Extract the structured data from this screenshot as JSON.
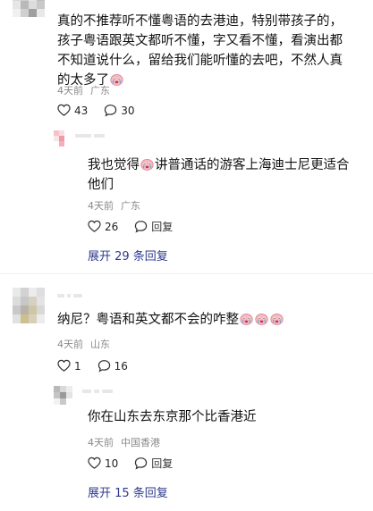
{
  "c1": {
    "text": "真的不推荐听不懂粤语的去港迪，特别带孩子的，孩子粤语跟英文都听不懂，字又看不懂，看演出都不知道说什么，留给我们能听懂的去吧，不然人真的太多了",
    "time": "4天前",
    "location": "广东",
    "likes": "43",
    "replies": "30",
    "emoji": "crying-face-icon"
  },
  "r1": {
    "text_a": "我也觉得",
    "text_b": "讲普通话的游客上海迪士尼更适合他们",
    "time": "4天前",
    "location": "广东",
    "likes": "26",
    "reply_label": "回复",
    "expand": "展开 29 条回复"
  },
  "c2": {
    "text": "纳尼？粤语和英文都不会的咋整",
    "time": "4天前",
    "location": "山东",
    "likes": "1",
    "replies": "16"
  },
  "r2": {
    "text": "你在山东去东京那个比香港近",
    "time": "4天前",
    "location": "中国香港",
    "likes": "10",
    "reply_label": "回复",
    "expand": "展开 15 条回复"
  },
  "colors": {
    "link": "#2d3a8c",
    "meta": "#8a8a8a",
    "emoji": "#f3a6b3"
  }
}
